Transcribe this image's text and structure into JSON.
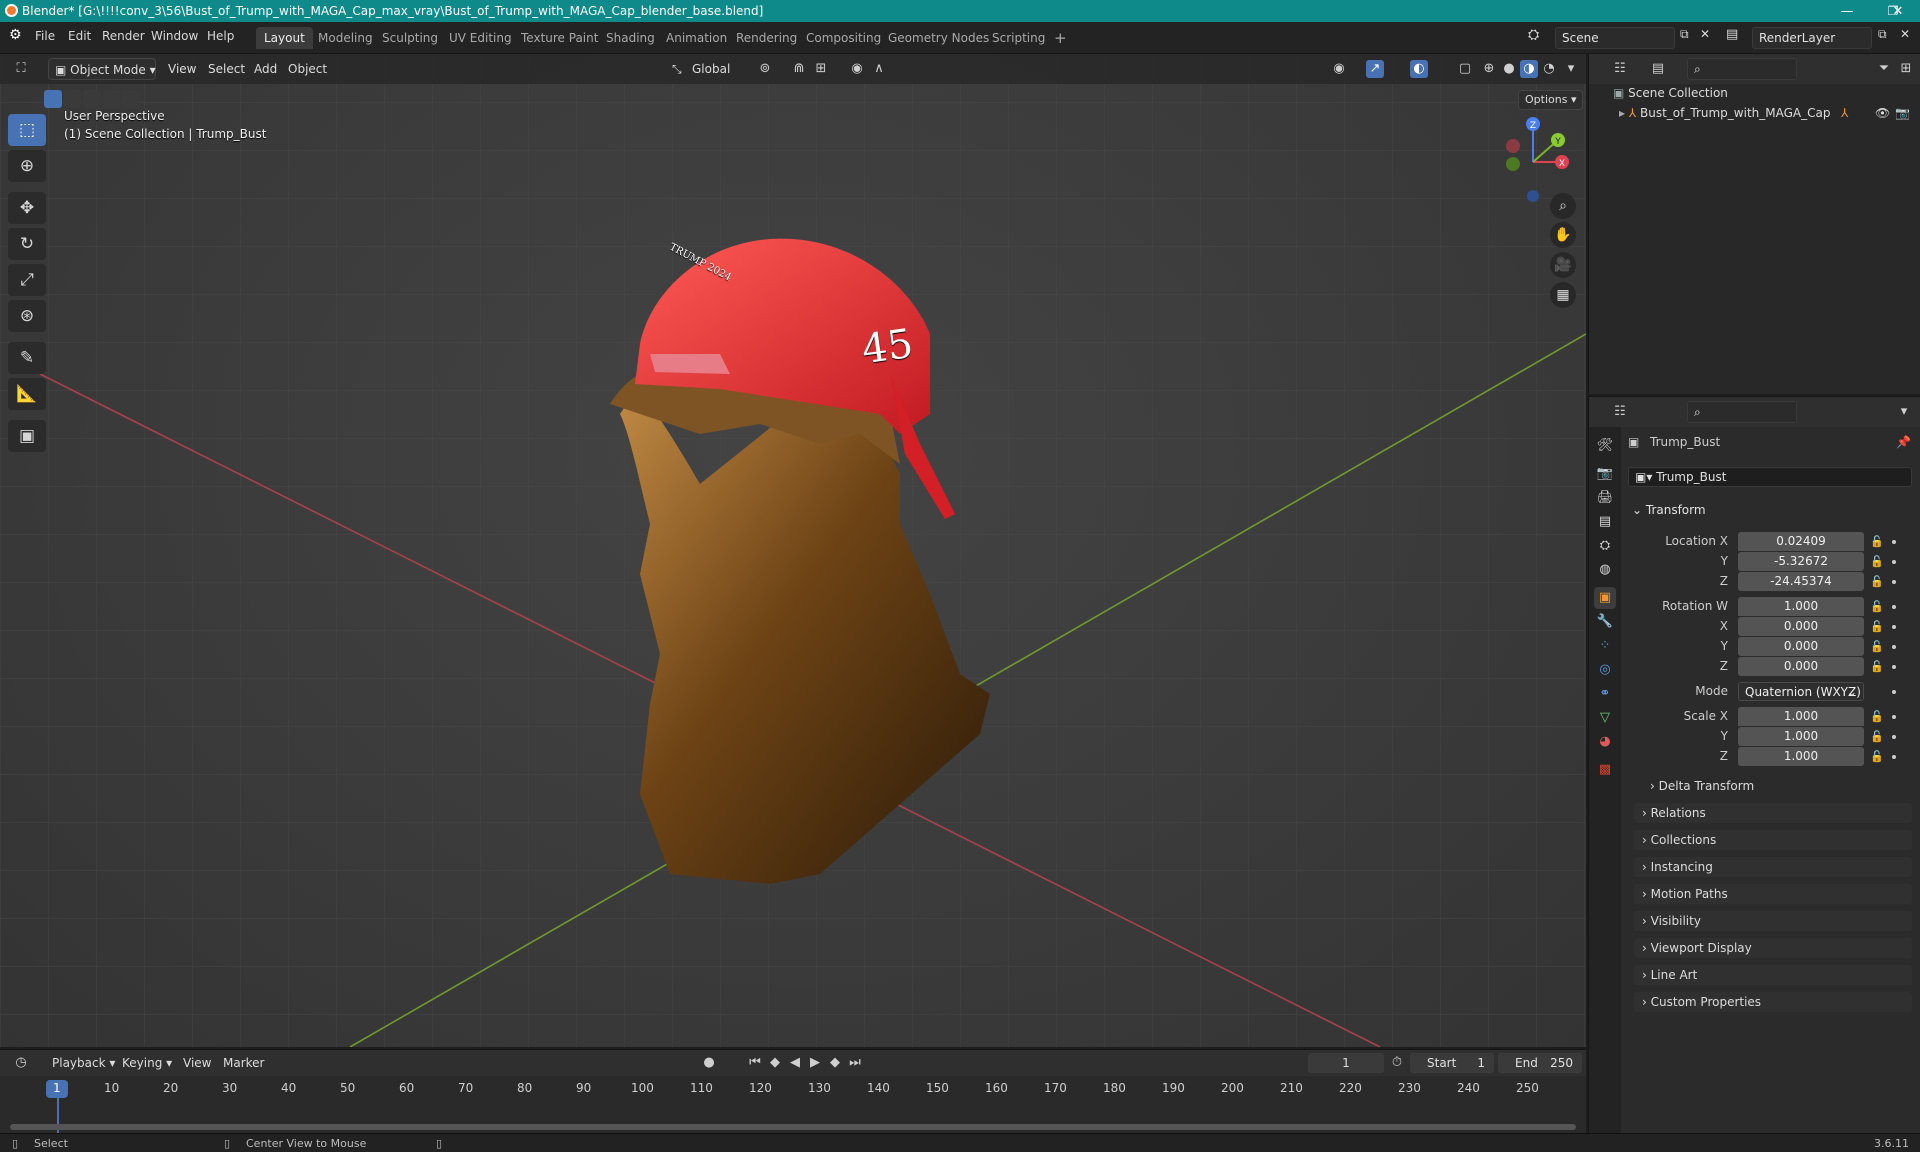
{
  "window": {
    "title": "Blender* [G:\\!!!!conv_3\\56\\Bust_of_Trump_with_MAGA_Cap_max_vray\\Bust_of_Trump_with_MAGA_Cap_blender_base.blend]",
    "minimize": "—",
    "maximize": "❐",
    "close": "✕"
  },
  "menu": {
    "items": [
      "File",
      "Edit",
      "Render",
      "Window",
      "Help"
    ]
  },
  "workspaces": {
    "tabs": [
      "Layout",
      "Modeling",
      "Sculpting",
      "UV Editing",
      "Texture Paint",
      "Shading",
      "Animation",
      "Rendering",
      "Compositing",
      "Geometry Nodes",
      "Scripting"
    ],
    "add": "+",
    "active": "Layout"
  },
  "scene": {
    "name": "Scene",
    "view_layer": "RenderLayer"
  },
  "viewport": {
    "mode": "Object Mode",
    "menus": [
      "View",
      "Select",
      "Add",
      "Object"
    ],
    "orientation": "Global",
    "options": "Options",
    "perspective": "User Perspective",
    "context": "(1) Scene Collection | Trump_Bust",
    "gizmo_axes": {
      "x": "X",
      "y": "Y",
      "z": "Z"
    },
    "model": {
      "cap_text": "TRUMP 2024",
      "cap_number": "45",
      "colors": {
        "cap": "#e0262b",
        "bronze": "#7a4a18"
      }
    }
  },
  "outliner": {
    "root": "Scene Collection",
    "items": [
      {
        "name": "Bust_of_Trump_with_MAGA_Cap"
      }
    ]
  },
  "properties": {
    "object_name": "Trump_Bust",
    "data_name": "Trump_Bust",
    "transform": {
      "header": "Transform",
      "location_label": "Location X",
      "location": [
        "0.02409",
        "-5.32672",
        "-24.45374"
      ],
      "rotation_label": "Rotation W",
      "rotation": [
        "1.000",
        "0.000",
        "0.000",
        "0.000"
      ],
      "mode_label": "Mode",
      "mode": "Quaternion (WXYZ)",
      "scale_label": "Scale X",
      "scale": [
        "1.000",
        "1.000",
        "1.000"
      ],
      "axis_labels": [
        "Y",
        "Z",
        "X"
      ],
      "delta": "Delta Transform"
    },
    "panels": [
      "Relations",
      "Collections",
      "Instancing",
      "Motion Paths",
      "Visibility",
      "Viewport Display",
      "Line Art",
      "Custom Properties"
    ]
  },
  "timeline": {
    "menus": [
      "Playback",
      "Keying",
      "View",
      "Marker"
    ],
    "current_frame": "1",
    "start_label": "Start",
    "start": "1",
    "end_label": "End",
    "end": "250",
    "ticks": [
      "1",
      "10",
      "20",
      "30",
      "40",
      "50",
      "60",
      "70",
      "80",
      "90",
      "100",
      "110",
      "120",
      "130",
      "140",
      "150",
      "160",
      "170",
      "180",
      "190",
      "200",
      "210",
      "220",
      "230",
      "240",
      "250"
    ]
  },
  "statusbar": {
    "left": "Select",
    "middle": "Center View to Mouse",
    "version": "3.6.11"
  }
}
